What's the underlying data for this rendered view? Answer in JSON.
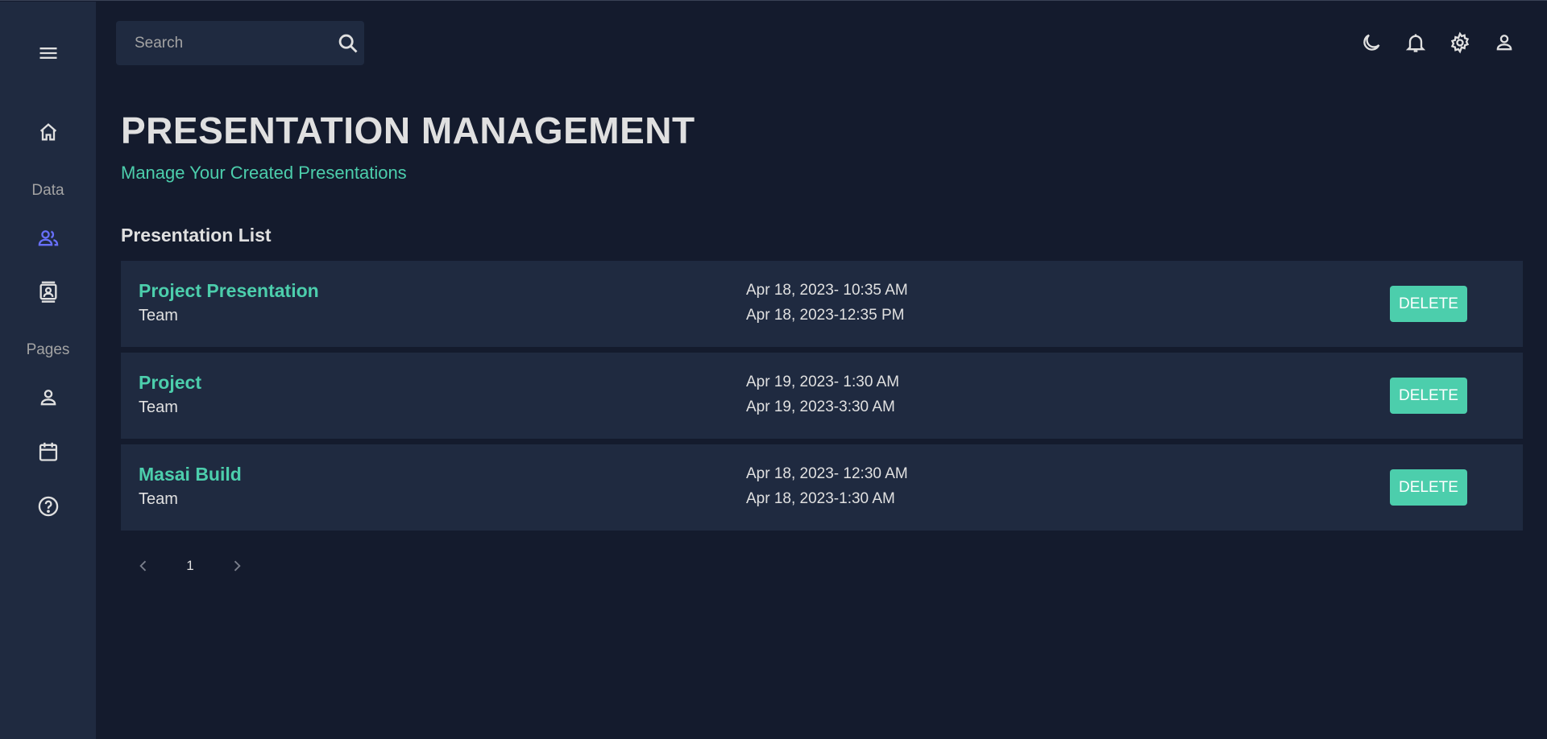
{
  "sidebar": {
    "items": [
      {
        "icon": "menu-icon"
      },
      {
        "icon": "home-icon"
      },
      {
        "icon": "team-icon",
        "active_color": "#6870fa"
      },
      {
        "icon": "contacts-icon"
      },
      {
        "icon": "person-icon"
      },
      {
        "icon": "calendar-icon"
      },
      {
        "icon": "help-icon"
      }
    ],
    "sections": {
      "data": "Data",
      "pages": "Pages"
    }
  },
  "search": {
    "placeholder": "Search"
  },
  "top_icons": [
    "dark-mode-icon",
    "notifications-icon",
    "settings-icon",
    "user-icon"
  ],
  "header": {
    "title": "PRESENTATION MANAGEMENT",
    "subtitle": "Manage Your Created Presentations"
  },
  "list": {
    "heading": "Presentation List",
    "delete_label": "DELETE",
    "rows": [
      {
        "name": "Project Presentation",
        "group": "Team",
        "start": "Apr 18, 2023- 10:35 AM",
        "end": "Apr 18, 2023-12:35 PM"
      },
      {
        "name": "Project",
        "group": "Team",
        "start": "Apr 19, 2023- 1:30 AM",
        "end": "Apr 19, 2023-3:30 AM"
      },
      {
        "name": "Masai Build",
        "group": "Team",
        "start": "Apr 18, 2023- 12:30 AM",
        "end": "Apr 18, 2023-1:30 AM"
      }
    ]
  },
  "pagination": {
    "current_page": "1"
  },
  "colors": {
    "accent": "#4cceac",
    "background": "#141b2d",
    "panel": "#1f2a40",
    "active_icon": "#6870fa"
  }
}
